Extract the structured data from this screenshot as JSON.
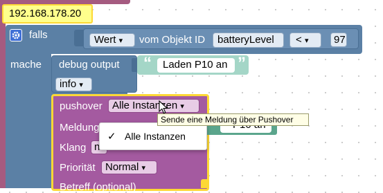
{
  "top_block": {
    "ip": "192.168.178.20"
  },
  "if_block": {
    "falls_label": "falls",
    "mache_label": "mache",
    "value_dropdown": "Wert",
    "object_text": "vom Objekt ID",
    "object_id": "batteryLevel",
    "operator": "<",
    "compare_value": "97"
  },
  "debug_block": {
    "label": "debug output",
    "string_value": "Laden P10 an",
    "level_dropdown": "info"
  },
  "pushover_block": {
    "label": "pushover",
    "instance_dropdown": "Alle Instanzen",
    "message_label": "Meldung",
    "message_value_partial": "P10 an",
    "sound_label": "Klang",
    "sound_value_partial": "n",
    "priority_label": "Priorität",
    "priority_dropdown": "Normal",
    "subject_label": "Betreff (optional)"
  },
  "tooltip": {
    "text": "Sende eine Meldung über Pushover"
  },
  "dropdown_menu": {
    "check": "✓",
    "items": [
      "Alle Instanzen"
    ]
  },
  "colors": {
    "logic_block": "#5b80a5",
    "logic_block_dark": "#4a6f94",
    "top_block": "#a55b80",
    "pushover_block": "#a45aa0",
    "highlight": "#fdd835",
    "string_block": "#5ba58c"
  }
}
